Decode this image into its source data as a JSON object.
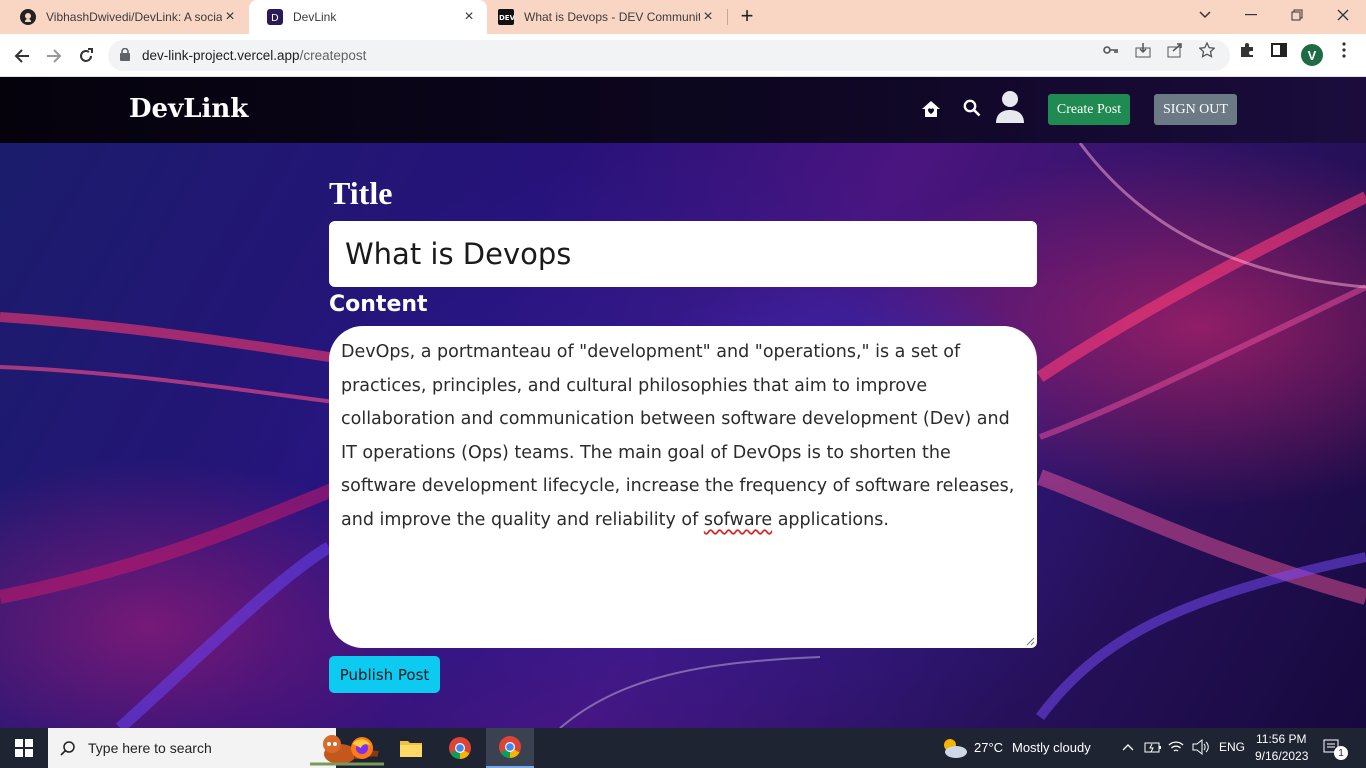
{
  "browser": {
    "tabs": [
      {
        "title": "VibhashDwivedi/DevLink: A socia",
        "icon": "github-icon",
        "active": false
      },
      {
        "title": "DevLink",
        "icon": "devlink-favicon",
        "active": true
      },
      {
        "title": "What is Devops - DEV Communit",
        "icon": "dev-to-icon",
        "active": false
      }
    ],
    "url_host": "dev-link-project.vercel.app",
    "url_path": "/createpost",
    "profile_initial": "V"
  },
  "header": {
    "brand": "DevLink",
    "create_post_label": "Create Post",
    "sign_out_label": "SIGN OUT"
  },
  "form": {
    "title_label": "Title",
    "title_value": "What is Devops",
    "content_label": "Content",
    "content_before": "DevOps, a portmanteau of \"development\" and \"operations,\" is a set of practices, principles, and cultural philosophies that aim to improve collaboration and communication between software development (Dev) and IT operations (Ops) teams. The main goal of DevOps is to shorten the software development lifecycle, increase the frequency of software releases, and improve the quality and reliability of ",
    "content_misspelled": "sofware",
    "content_after": " applications.",
    "publish_label": "Publish Post"
  },
  "taskbar": {
    "search_placeholder": "Type here to search",
    "weather_temp": "27°C",
    "weather_desc": "Mostly cloudy",
    "language": "ENG",
    "time": "11:56 PM",
    "date": "9/16/2023",
    "notification_count": "1"
  },
  "colors": {
    "create_post": "#1f8a52",
    "sign_out": "#6c7a86",
    "publish": "#0dcaf0",
    "tabstrip": "#f9d6c3"
  }
}
